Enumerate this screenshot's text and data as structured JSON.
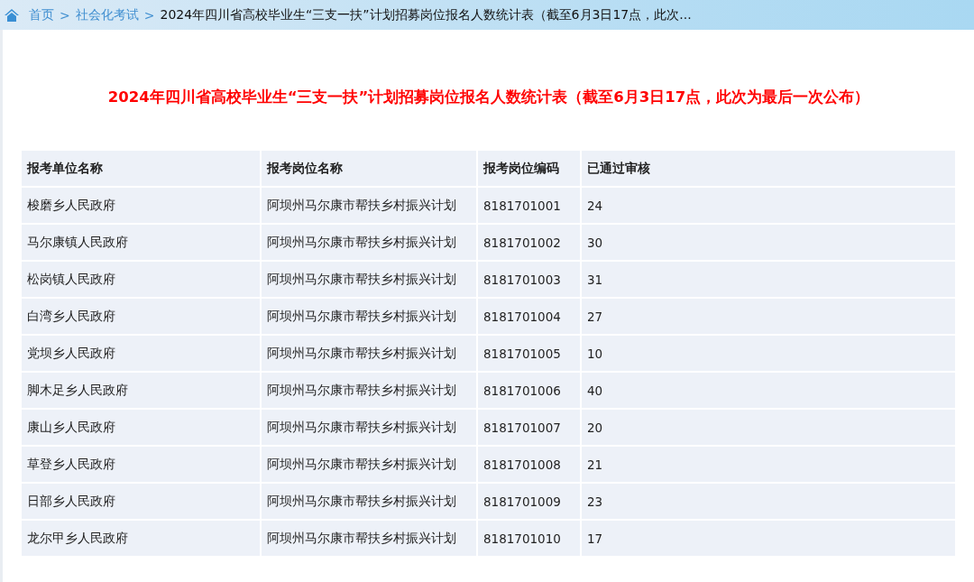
{
  "breadcrumb": {
    "items": [
      "首页",
      "社会化考试"
    ],
    "separator": ">",
    "current": "2024年四川省高校毕业生“三支一扶”计划招募岗位报名人数统计表（截至6月3日17点，此次..."
  },
  "title": "2024年四川省高校毕业生“三支一扶”计划招募岗位报名人数统计表（截至6月3日17点，此次为最后一次公布）",
  "table": {
    "columns": [
      "报考单位名称",
      "报考岗位名称",
      "报考岗位编码",
      "已通过审核"
    ],
    "rows": [
      [
        "梭磨乡人民政府",
        "阿坝州马尔康市帮扶乡村振兴计划",
        "8181701001",
        "24"
      ],
      [
        "马尔康镇人民政府",
        "阿坝州马尔康市帮扶乡村振兴计划",
        "8181701002",
        "30"
      ],
      [
        "松岗镇人民政府",
        "阿坝州马尔康市帮扶乡村振兴计划",
        "8181701003",
        "31"
      ],
      [
        "白湾乡人民政府",
        "阿坝州马尔康市帮扶乡村振兴计划",
        "8181701004",
        "27"
      ],
      [
        "党坝乡人民政府",
        "阿坝州马尔康市帮扶乡村振兴计划",
        "8181701005",
        "10"
      ],
      [
        "脚木足乡人民政府",
        "阿坝州马尔康市帮扶乡村振兴计划",
        "8181701006",
        "40"
      ],
      [
        "康山乡人民政府",
        "阿坝州马尔康市帮扶乡村振兴计划",
        "8181701007",
        "20"
      ],
      [
        "草登乡人民政府",
        "阿坝州马尔康市帮扶乡村振兴计划",
        "8181701008",
        "21"
      ],
      [
        "日部乡人民政府",
        "阿坝州马尔康市帮扶乡村振兴计划",
        "8181701009",
        "23"
      ],
      [
        "龙尔甲乡人民政府",
        "阿坝州马尔康市帮扶乡村振兴计划",
        "8181701010",
        "17"
      ]
    ]
  }
}
